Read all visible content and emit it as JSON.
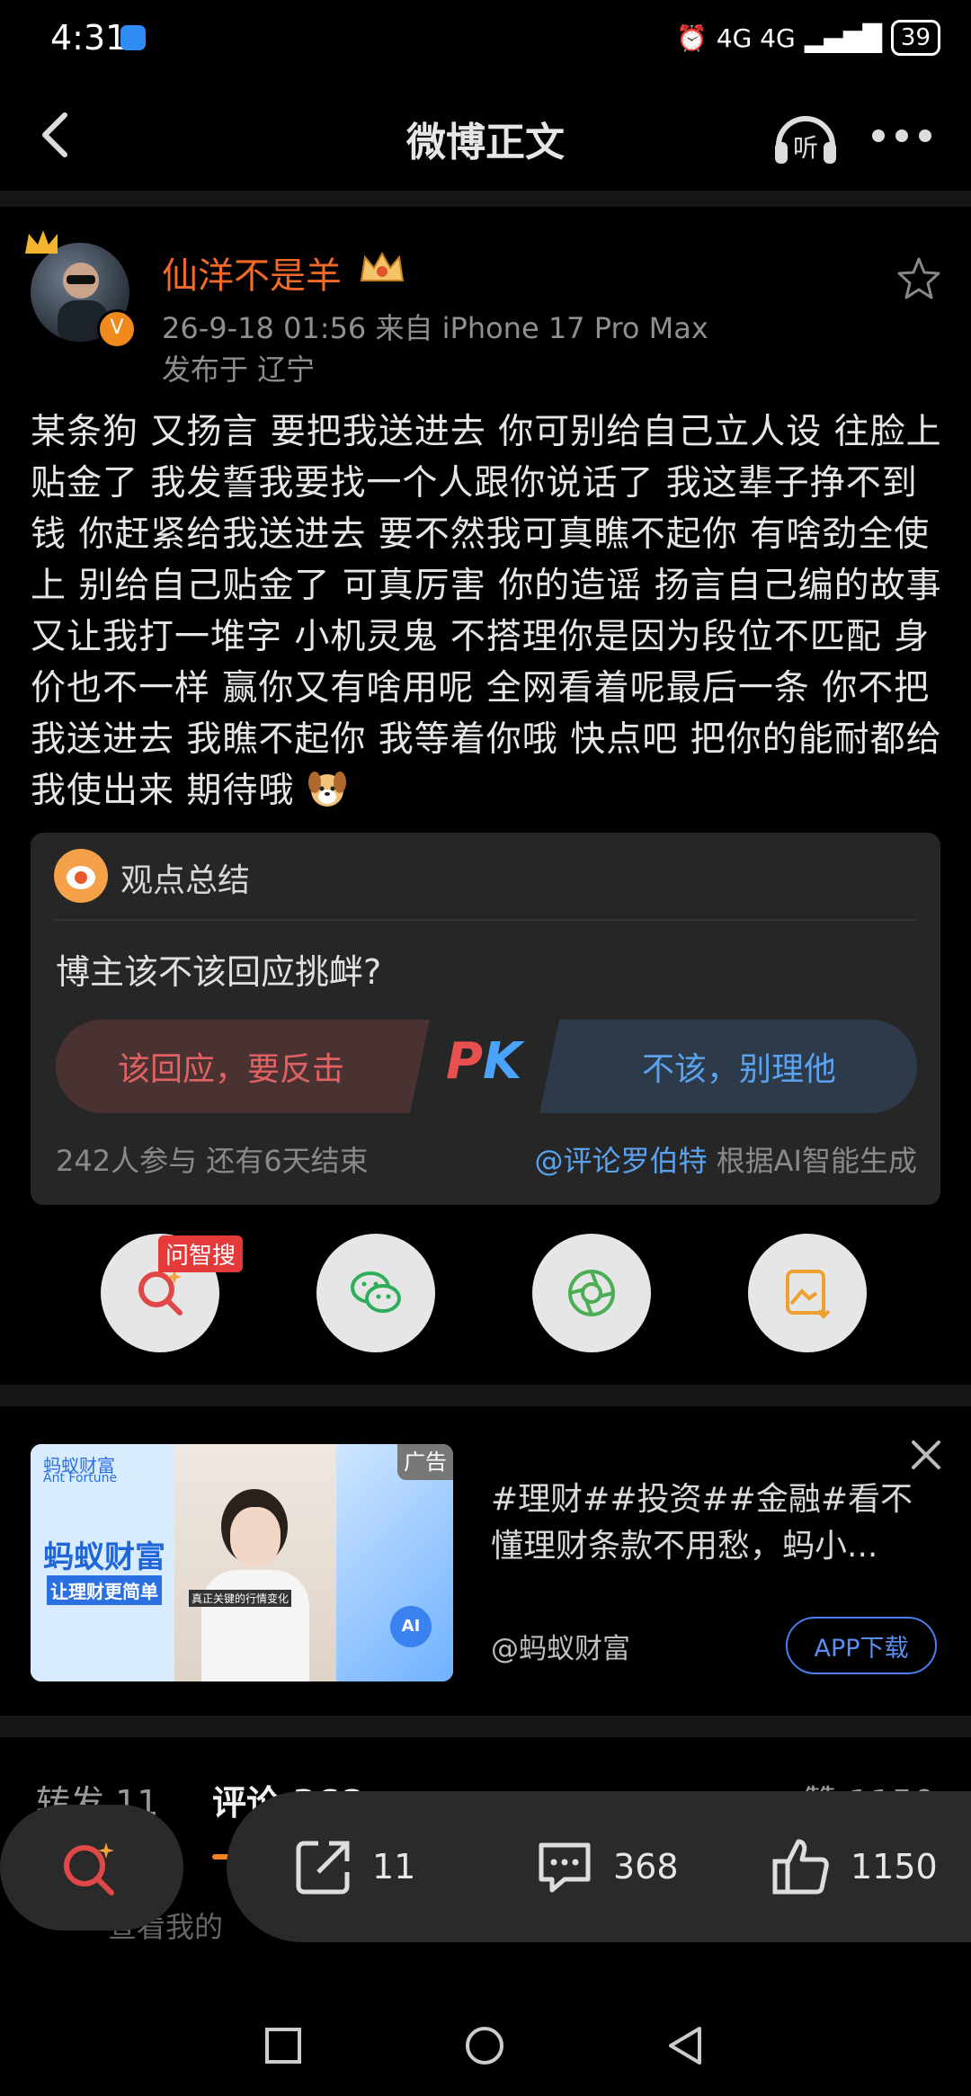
{
  "status_bar": {
    "time": "4:31",
    "network": "4G 4G",
    "battery": "39"
  },
  "header": {
    "title": "微博正文",
    "listen_label": "听",
    "icons": [
      "back-arrow-icon",
      "listen-headphones-icon",
      "more-dots-icon"
    ]
  },
  "post": {
    "author": "仙洋不是羊",
    "verified_badge": "V",
    "timestamp_source": "26-9-18 01:56  来自 iPhone 17 Pro Max",
    "location": "发布于 辽宁",
    "text": "某条狗 又扬言 要把我送进去 你可别给自己立人设 往脸上贴金了 我发誓我要找一个人跟你说话了 我这辈子挣不到钱 你赶紧给我送进去 要不然我可真瞧不起你 有啥劲全使上  别给自己贴金了 可真厉害 你的造谣 扬言自己编的故事又让我打一堆字 小机灵鬼 不搭理你是因为段位不匹配 身价也不一样 赢你又有啥用呢 全网看着呢最后一条 你不把我送进去 我瞧不起你 我等着你哦 快点吧 把你的能耐都给我使出来 期待哦 "
  },
  "summary_card": {
    "title": "观点总结",
    "question": "博主该不该回应挑衅?",
    "option_left": "该回应，要反击",
    "pk_label": "PK",
    "option_right": "不该，别理他",
    "participants": "242人参与  还有6天结束",
    "ai_mention": "@评论罗伯特",
    "ai_note": " 根据AI智能生成"
  },
  "share_row": {
    "badge": "问智搜",
    "items": [
      "ai-search-icon",
      "wechat-icon",
      "moments-icon",
      "save-image-icon"
    ]
  },
  "ad": {
    "tag": "广告",
    "brand_logo": "蚂蚁财富",
    "brand_logo_en": "Ant Fortune",
    "brand_big": "蚂蚁财富",
    "slogan": "让理财更简单",
    "image_caption": "真正关键的行情变化",
    "ai_badge": "AI",
    "text": "#理财##投资##金融#看不懂理财条款不用愁，蚂小...",
    "author": "@蚂蚁财富",
    "button": "APP下载"
  },
  "tabs": {
    "repost": "转发 11",
    "comment": "评论 368",
    "like": "赞 1150",
    "hint": "查看我的"
  },
  "action_bar": {
    "repost_count": "11",
    "comment_count": "368",
    "like_count": "1150"
  },
  "colors": {
    "accent_orange": "#f26a26",
    "link_blue": "#5aa2ee",
    "pk_red": "#e85050",
    "pk_blue": "#4aa3ff"
  }
}
